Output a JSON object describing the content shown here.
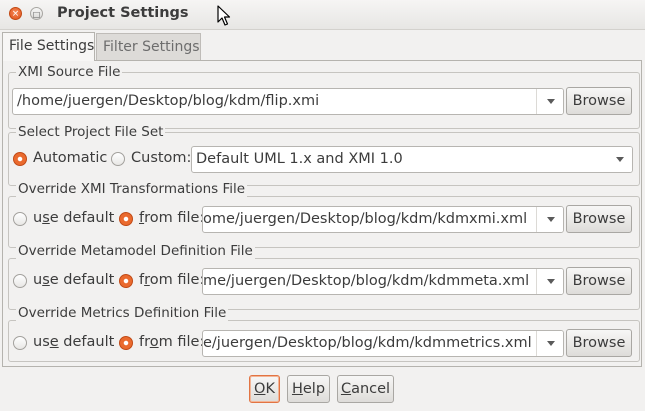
{
  "window": {
    "title": "Project Settings",
    "close_glyph": "×",
    "max_glyph": "□"
  },
  "tabs": [
    {
      "label": "File Settings",
      "active": true
    },
    {
      "label": "Filter Settings",
      "active": false
    }
  ],
  "groups": {
    "xmi_source": {
      "legend": "XMI Source File",
      "value": "/home/juergen/Desktop/blog/kdm/flip.xmi",
      "browse_label": "Browse"
    },
    "file_set": {
      "legend": "Select Project File Set",
      "automatic_label": "Automatic",
      "custom_label": "Custom:",
      "selected": "automatic",
      "combo_value": "Default UML 1.x and XMI 1.0"
    },
    "xmi_transform": {
      "legend": "Override XMI Transformations File",
      "use_default_pre": "u",
      "use_default_mn": "s",
      "use_default_post": "e default",
      "from_file_pre": "",
      "from_file_mn": "f",
      "from_file_post": "rom file:",
      "selected": "from_file",
      "value": "ome/juergen/Desktop/blog/kdm/kdmxmi.xml",
      "browse_label": "Browse"
    },
    "metamodel": {
      "legend": "Override Metamodel Definition File",
      "use_default_pre": "u",
      "use_default_mn": "s",
      "use_default_post": "e default",
      "from_file_pre": "f",
      "from_file_mn": "r",
      "from_file_post": "om file:",
      "selected": "from_file",
      "value": "me/juergen/Desktop/blog/kdm/kdmmeta.xml",
      "browse_label": "Browse"
    },
    "metrics": {
      "legend": "Override Metrics Definition File",
      "use_default_pre": "us",
      "use_default_mn": "e",
      "use_default_post": " default",
      "from_file_pre": "fr",
      "from_file_mn": "o",
      "from_file_post": "m file:",
      "selected": "from_file",
      "value": "e/juergen/Desktop/blog/kdm/kdmmetrics.xml",
      "browse_label": "Browse"
    }
  },
  "footer": {
    "ok_mn": "O",
    "ok_rest": "K",
    "help_mn": "H",
    "help_rest": "elp",
    "cancel_mn": "C",
    "cancel_rest": "ancel"
  },
  "colors": {
    "accent": "#ea6a2e",
    "window_bg": "#f2f1f0"
  }
}
